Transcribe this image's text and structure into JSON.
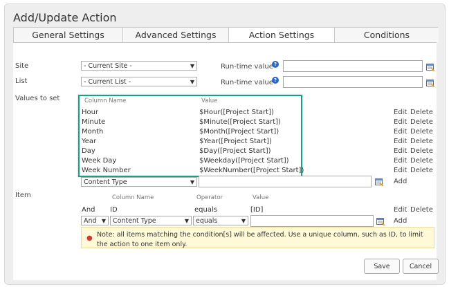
{
  "dialog": {
    "title": "Add/Update Action"
  },
  "tabs": [
    {
      "label": "General Settings"
    },
    {
      "label": "Advanced Settings"
    },
    {
      "label": "Action Settings"
    },
    {
      "label": "Conditions"
    }
  ],
  "site": {
    "label": "Site",
    "value": "- Current Site -",
    "runtime_label": "Run-time value"
  },
  "list": {
    "label": "List",
    "value": "- Current List -",
    "runtime_label": "Run-time value"
  },
  "values": {
    "label": "Values to set",
    "col_name_header": "Column Name",
    "value_header": "Value",
    "rows": [
      {
        "name": "Hour",
        "value": "$Hour([Project Start])"
      },
      {
        "name": "Minute",
        "value": "$Minute([Project Start])"
      },
      {
        "name": "Month",
        "value": "$Month([Project Start])"
      },
      {
        "name": "Year",
        "value": "$Year([Project Start])"
      },
      {
        "name": "Day",
        "value": "$Day([Project Start])"
      },
      {
        "name": "Week Day",
        "value": "$Weekday([Project Start])"
      },
      {
        "name": "Week Number",
        "value": "$WeekNumber([Project Start])"
      }
    ],
    "edit_label": "Edit",
    "delete_label": "Delete",
    "new_column_value": "Content Type",
    "add_label": "Add"
  },
  "item": {
    "label": "Item",
    "col_name_header": "Column Name",
    "operator_header": "Operator",
    "value_header": "Value",
    "row": {
      "join": "And",
      "column": "ID",
      "operator": "equals",
      "value": "[ID]"
    },
    "edit_label": "Edit",
    "delete_label": "Delete",
    "new_join": "And",
    "new_column": "Content Type",
    "new_operator": "equals",
    "add_label": "Add",
    "note": "Note: all items matching the condition[s] will be affected. Use a unique column, such as ID, to limit the action to one item only."
  },
  "buttons": {
    "save": "Save",
    "cancel": "Cancel"
  },
  "colors": {
    "highlight": "#1b9e82",
    "help_icon": "#2a66c4",
    "note_bg": "#fff9d8"
  }
}
